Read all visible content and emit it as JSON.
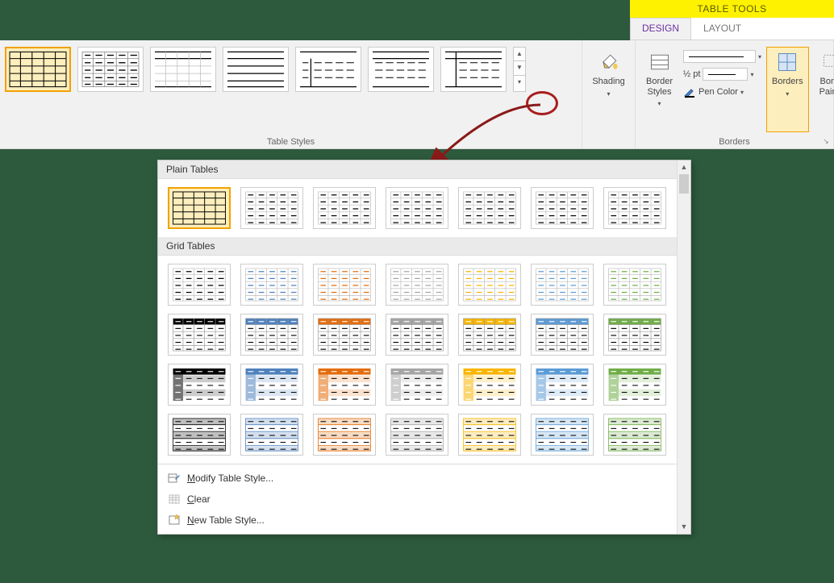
{
  "tools_tab": "TABLE TOOLS",
  "tabs": {
    "design": "DESIGN",
    "layout": "LAYOUT"
  },
  "ribbon": {
    "table_styles_label": "Table Styles",
    "borders_label": "Borders",
    "shading": "Shading",
    "border_styles": "Border\nStyles",
    "line_weight": "½ pt",
    "pen_color": "Pen Color",
    "borders": "Borders",
    "border_painter": "Border\nPainter"
  },
  "popup": {
    "section_plain": "Plain Tables",
    "section_grid": "Grid Tables",
    "menu": {
      "modify": "Modify Table Style...",
      "clear": "Clear",
      "new": "New Table Style..."
    }
  },
  "style_colors": {
    "plain": [
      "#000000",
      "#000000",
      "#000000",
      "#000000",
      "#000000",
      "#000000",
      "#000000"
    ],
    "grid_rows": [
      [
        "#000000",
        "#4f81bd",
        "#c0504d",
        "#9bbb59",
        "#8064a2",
        "#f7b500",
        "#4bacc6",
        "#70ad47"
      ],
      [
        "#000000",
        "#4f81bd",
        "#c0504d",
        "#9bbb59",
        "#8064a2",
        "#f7b500",
        "#4bacc6",
        "#70ad47"
      ],
      [
        "#000000",
        "#4f81bd",
        "#c0504d",
        "#9bbb59",
        "#8064a2",
        "#f7b500",
        "#4bacc6",
        "#70ad47"
      ],
      [
        "#000000",
        "#4f81bd",
        "#c0504d",
        "#9bbb59",
        "#8064a2",
        "#f7b500",
        "#4bacc6",
        "#70ad47"
      ]
    ]
  }
}
